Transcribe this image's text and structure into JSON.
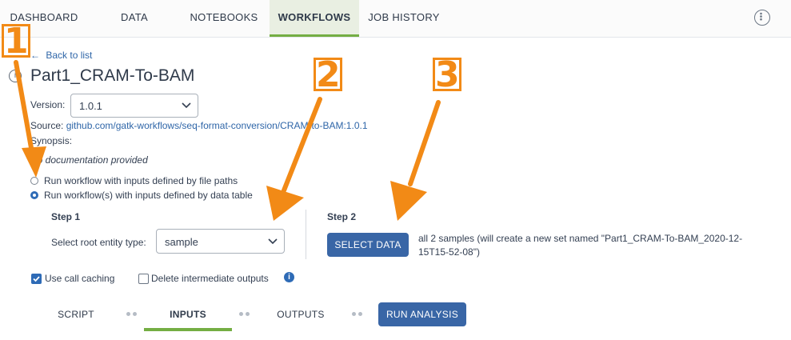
{
  "nav": {
    "tabs": [
      {
        "label": "DASHBOARD"
      },
      {
        "label": "DATA"
      },
      {
        "label": "NOTEBOOKS"
      },
      {
        "label": "WORKFLOWS"
      },
      {
        "label": "JOB HISTORY"
      }
    ],
    "menu_icon": "vertical-ellipsis-icon"
  },
  "back_link": "Back to list",
  "workflow": {
    "name": "Part1_CRAM-To-BAM",
    "version_label": "Version:",
    "version_value": "1.0.1",
    "source_label": "Source:",
    "source_value": "github.com/gatk-workflows/seq-format-conversion/CRAM-to-BAM:1.0.1",
    "synopsis_label": "Synopsis:",
    "documentation": "No documentation provided"
  },
  "run_options": {
    "option_file_paths": "Run workflow with inputs defined by file paths",
    "option_data_table": "Run workflow(s) with inputs defined by data table",
    "selected": "data_table"
  },
  "step1": {
    "title": "Step 1",
    "root_entity_label": "Select root entity type:",
    "root_entity_value": "sample"
  },
  "step2": {
    "title": "Step 2",
    "select_data_button": "SELECT DATA",
    "selection_line1": "all 2 samples (will create a new set named \"Part1_CRAM-To-BAM_2020-12-",
    "selection_line2": "15T15-52-08\")"
  },
  "options": {
    "call_caching_label": "Use call caching",
    "call_caching_checked": true,
    "delete_intermediate_label": "Delete intermediate outputs",
    "delete_intermediate_checked": false
  },
  "subtabs": {
    "script": "SCRIPT",
    "inputs": "INPUTS",
    "outputs": "OUTPUTS",
    "run_button": "RUN ANALYSIS"
  },
  "callouts": [
    "1",
    "2",
    "3"
  ],
  "colors": {
    "accent_green": "#74ae43",
    "primary_blue": "#3966a6",
    "link_blue": "#2f66a8",
    "callout_orange": "#f28a16"
  }
}
